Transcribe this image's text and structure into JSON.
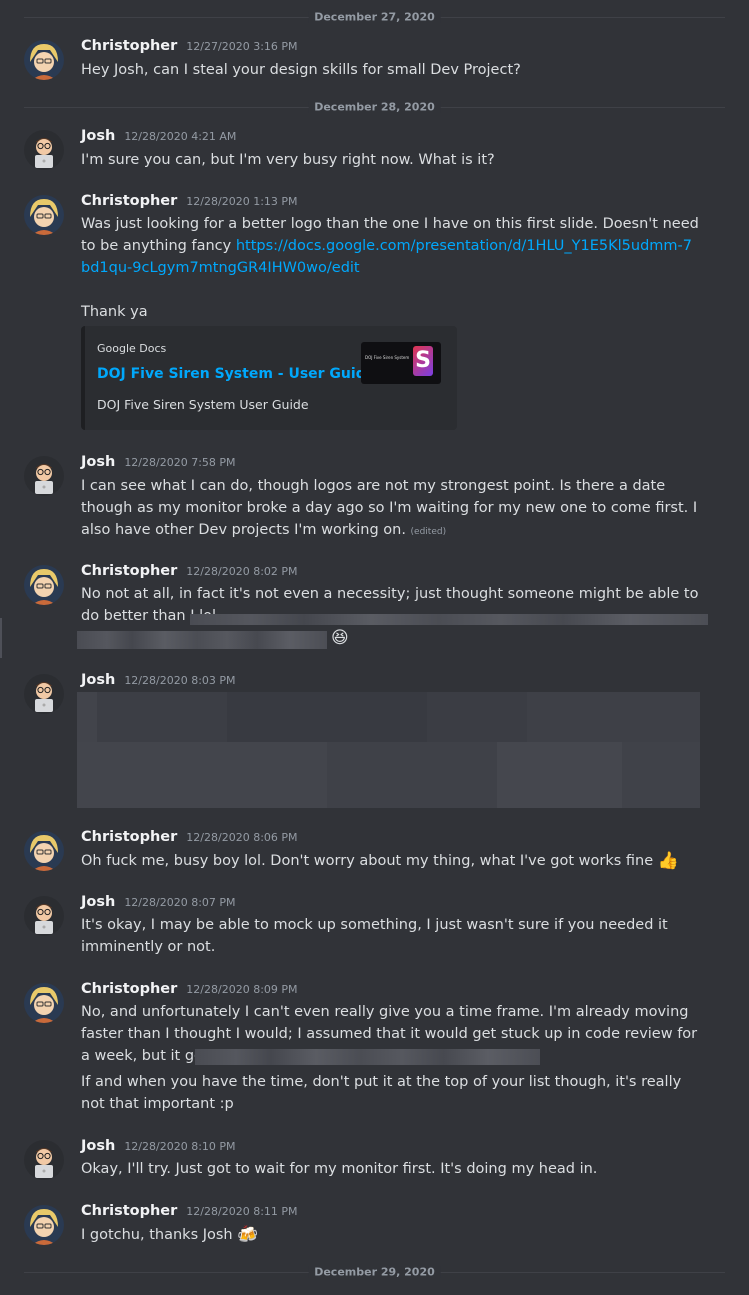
{
  "dates": {
    "d1": "December 27, 2020",
    "d2": "December 28, 2020",
    "d3": "December 29, 2020"
  },
  "users": {
    "christopher": "Christopher",
    "josh": "Josh"
  },
  "messages": [
    {
      "author": "Christopher",
      "time": "12/27/2020 3:16 PM",
      "text": "Hey Josh, can I steal your design skills for small Dev Project?"
    },
    {
      "author": "Josh",
      "time": "12/28/2020 4:21 AM",
      "text": "I'm sure you can, but I'm very busy right now. What is it?"
    },
    {
      "author": "Christopher",
      "time": "12/28/2020 1:13 PM",
      "text": "Was just looking for a better logo than the one I have on this first slide. Doesn't need to be anything fancy ",
      "link": "https://docs.google.com/presentation/d/1HLU_Y1E5Kl5udmm-7bd1qu-9cLgym7mtngGR4IHW0wo/edit",
      "text2": "Thank ya"
    },
    {
      "author": "Josh",
      "time": "12/28/2020 7:58 PM",
      "text": "I can see what I can do, though logos are not my strongest point. Is there a date though as my monitor broke a day ago so I'm waiting for my new one to come first. I also have other Dev projects I'm working on.",
      "edited": "(edited)"
    },
    {
      "author": "Christopher",
      "time": "12/28/2020 8:02 PM",
      "text": "No not at all, in fact it's not even a necessity; just thought someone might be able to do better than I lol.",
      "emoji": "😆"
    },
    {
      "author": "Josh",
      "time": "12/28/2020 8:03 PM"
    },
    {
      "author": "Christopher",
      "time": "12/28/2020 8:06 PM",
      "text": "Oh fuck me, busy boy lol. Don't worry about my thing, what I've got works fine",
      "emoji": "👍"
    },
    {
      "author": "Josh",
      "time": "12/28/2020 8:07 PM",
      "text": "It's okay, I may be able to mock up something, I just wasn't sure if you needed it imminently or not."
    },
    {
      "author": "Christopher",
      "time": "12/28/2020 8:09 PM",
      "text": "No, and unfortunately I can't even really give you a time frame. I'm already moving faster than I thought I would; I assumed that it would get stuck up in code review for a week, but it got through in a Day",
      "text2": "If and when you have the time, don't put it at the top of your list though, it's really not that important :p"
    },
    {
      "author": "Josh",
      "time": "12/28/2020 8:10 PM",
      "text": "Okay, I'll try. Just got to wait for my monitor first. It's doing my head in."
    },
    {
      "author": "Christopher",
      "time": "12/28/2020 8:11 PM",
      "text": "I gotchu, thanks Josh",
      "emoji": "🍻"
    }
  ],
  "embed": {
    "provider": "Google Docs",
    "title": "DOJ Five Siren System - User Guide",
    "description": "DOJ Five Siren System User Guide",
    "thumb_text": "DOJ Five Siren System",
    "thumb_logo": "S"
  },
  "colors": {
    "background": "#313338",
    "link": "#00a8fc",
    "author": "#f2f3f5",
    "timestamp": "#949ba4"
  }
}
